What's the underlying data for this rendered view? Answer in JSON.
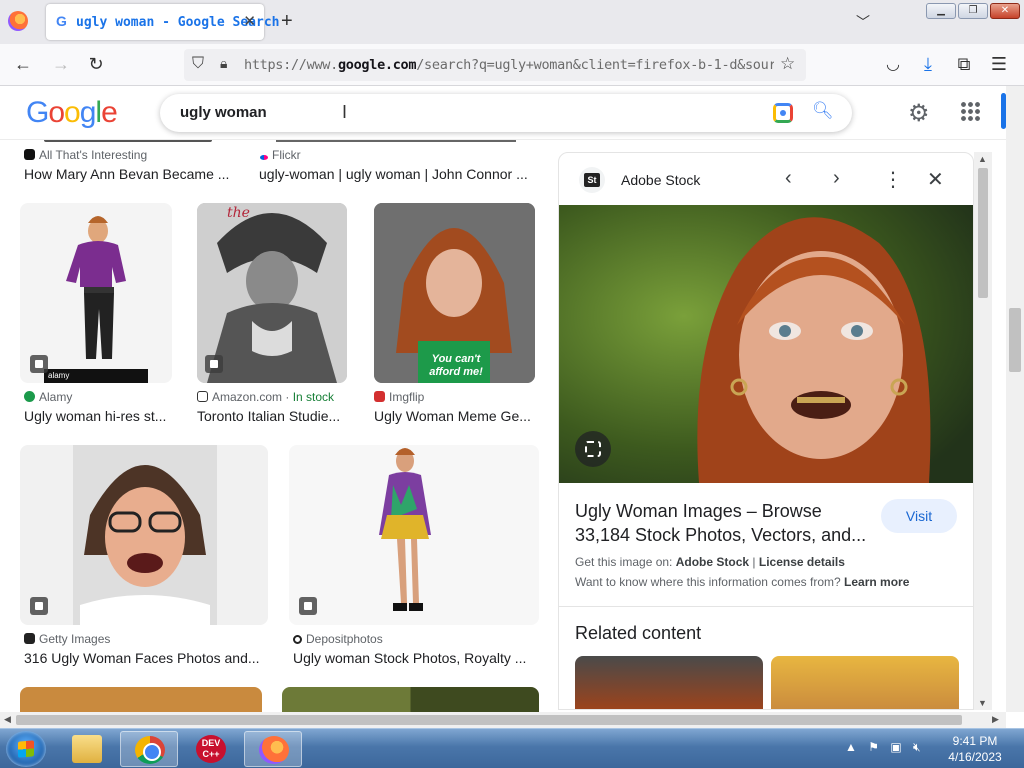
{
  "browser": {
    "tab_title": "ugly woman - Google Search",
    "tab_favicon": "G",
    "url_prefix": "https://www.",
    "url_domain": "google.com",
    "url_rest": "/search?q=ugly+woman&client=firefox-b-1-d&source=l"
  },
  "google": {
    "logo_letters": [
      "G",
      "o",
      "o",
      "g",
      "l",
      "e"
    ],
    "logo_colors": [
      "#4285f4",
      "#ea4335",
      "#fbbc05",
      "#4285f4",
      "#34a853",
      "#ea4335"
    ],
    "query": "ugly woman"
  },
  "results": [
    {
      "source": "All That's Interesting",
      "title": "How Mary Ann Bevan Became ..."
    },
    {
      "source": "Flickr",
      "title": "ugly-woman | ugly woman | John Connor ..."
    },
    {
      "source": "Alamy",
      "title": "Ugly woman hi-res st..."
    },
    {
      "source": "Amazon.com",
      "stock": "In stock",
      "title": "Toronto Italian Studie..."
    },
    {
      "source": "Imgflip",
      "title": "Ugly Woman Meme Ge..."
    },
    {
      "source": "Getty Images",
      "title": "316 Ugly Woman Faces Photos and..."
    },
    {
      "source": "Depositphotos",
      "title": "Ugly woman Stock Photos, Royalty ..."
    }
  ],
  "meme_text": "You can't afford me!",
  "alamy_watermark": "alamy",
  "panel": {
    "site": "Adobe Stock",
    "site_logo": "St",
    "title": "Ugly Woman Images – Browse 33,184 Stock Photos, Vectors, and...",
    "visit": "Visit",
    "get_image_prefix": "Get this image on:",
    "get_image_site": "Adobe Stock",
    "license": "License details",
    "why_prefix": "Want to know where this information comes from?",
    "learn_more": "Learn more",
    "related": "Related content"
  },
  "taskbar": {
    "time": "9:41 PM",
    "date": "4/16/2023",
    "devcpp_label": "DEV C++"
  },
  "colors": {
    "accent": "#1a73e8",
    "stock_green": "#188038",
    "taskbar": "#4a76aa"
  }
}
